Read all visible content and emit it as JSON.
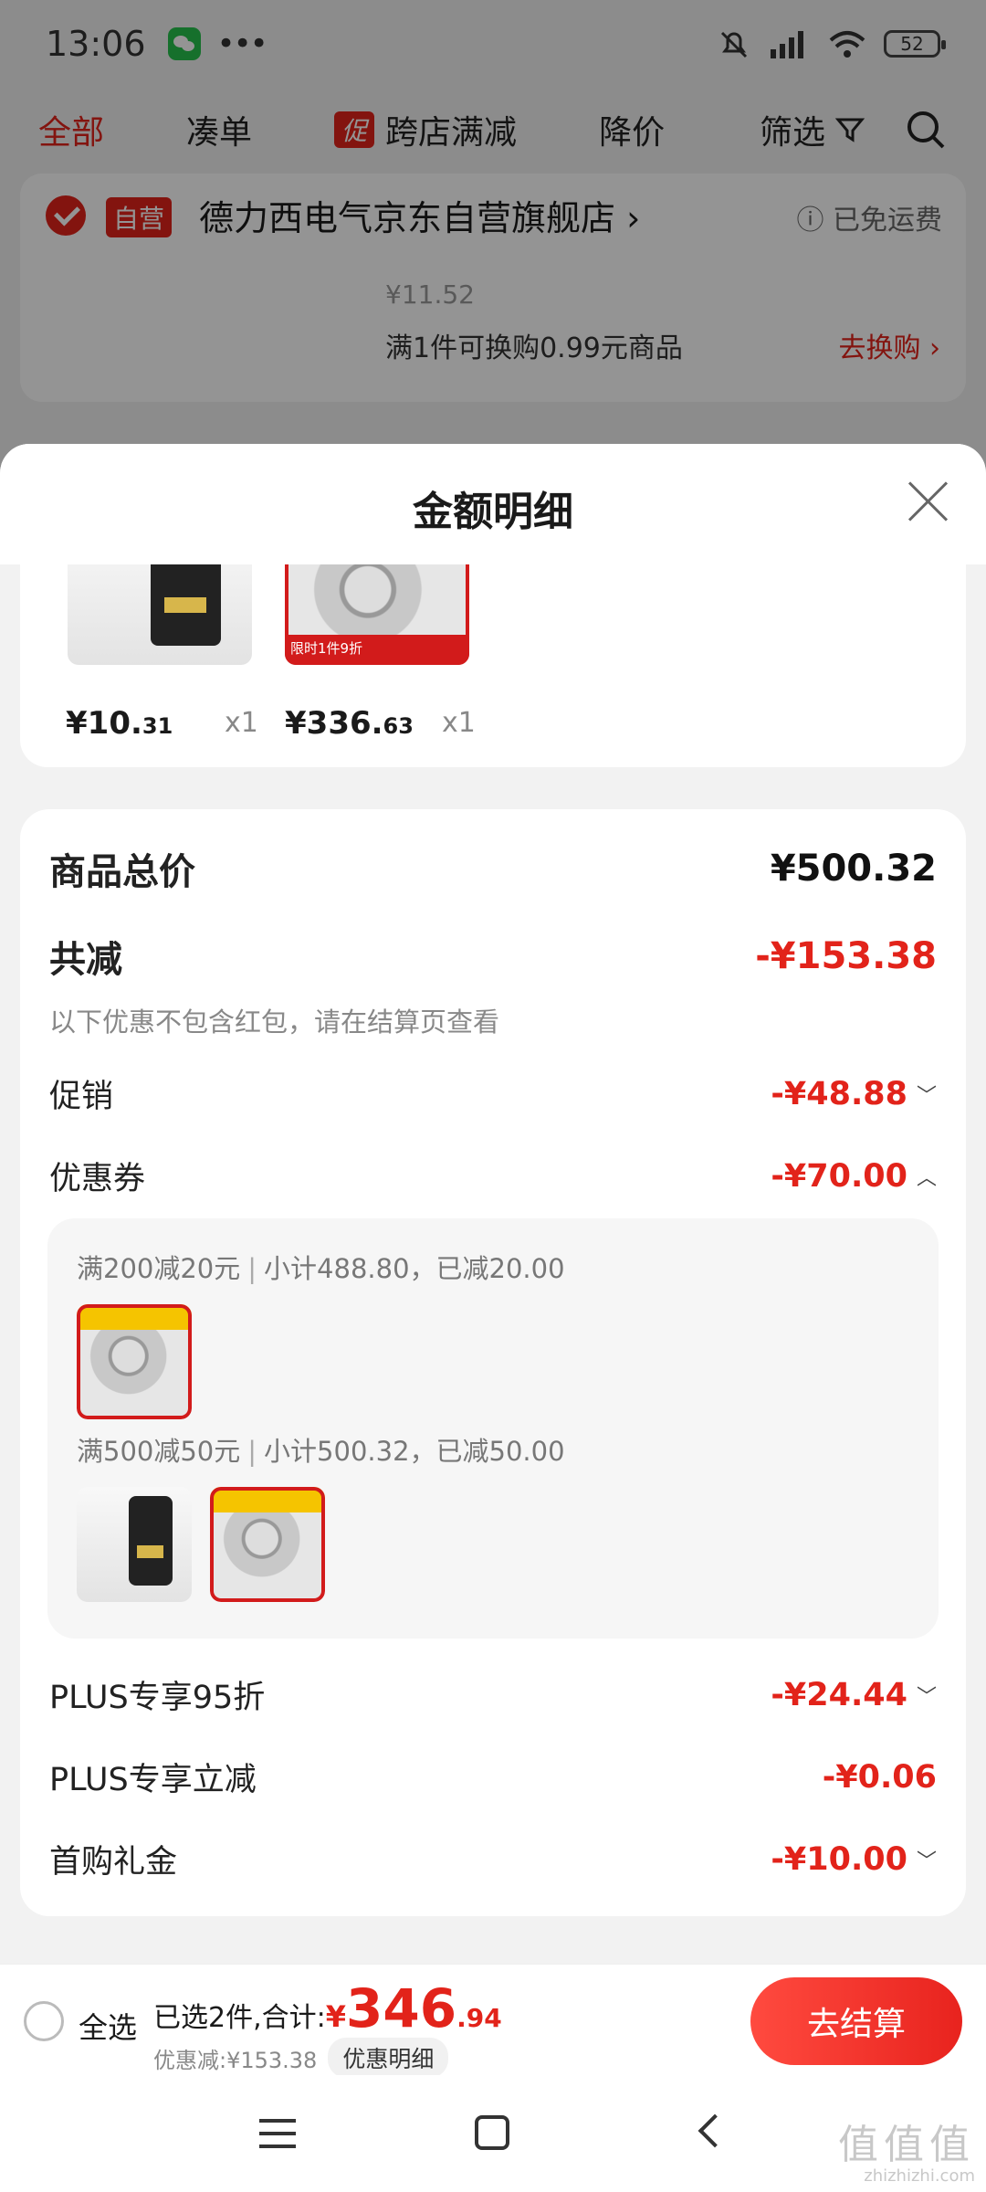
{
  "status_bar": {
    "time": "13:06",
    "battery": "52"
  },
  "tabs": {
    "all": "全部",
    "bundle": "凑单",
    "promo_badge": "促",
    "cross_store": "跨店满减",
    "price_drop": "降价",
    "filter": "筛选"
  },
  "store": {
    "badge": "自营",
    "name": "德力西电气京东自营旗舰店 ›",
    "shipping": "ⓘ 已免运费",
    "price": "¥11.52",
    "promo": "满1件可换购0.99元商品",
    "swap": "去换购 ›"
  },
  "sheet": {
    "title": "金额明细"
  },
  "products": [
    {
      "price_int": "¥10.",
      "price_dec": "31",
      "qty": "x1"
    },
    {
      "price_int": "¥336.",
      "price_dec": "63",
      "qty": "x1",
      "tag": "限时1件9折"
    }
  ],
  "summary": {
    "goods_total_label": "商品总价",
    "goods_total_value": "¥500.32",
    "total_discount_label": "共减",
    "total_discount_value": "-¥153.38",
    "hint": "以下优惠不包含红包，请在结算页查看",
    "promotion_label": "促销",
    "promotion_value": "-¥48.88",
    "coupon_label": "优惠券",
    "coupon_value": "-¥70.00",
    "coupon1_rule": "满200减20元",
    "coupon1_detail": "小计488.80，已减20.00",
    "coupon2_rule": "满500减50元",
    "coupon2_detail": "小计500.32，已减50.00",
    "plus95_label": "PLUS专享95折",
    "plus95_value": "-¥24.44",
    "plus_cut_label": "PLUS专享立减",
    "plus_cut_value": "-¥0.06",
    "first_gift_label": "首购礼金",
    "first_gift_value": "-¥10.00"
  },
  "bottom_bar": {
    "select_all": "全选",
    "selected_text": "已选2件,合计:",
    "currency": "¥",
    "total_int": "346",
    "total_dec": ".94",
    "discount": "优惠减:¥153.38",
    "detail_button": "优惠明细",
    "checkout": "去结算"
  },
  "watermark": {
    "text": "值值值",
    "url": "zhizhizhi.com"
  },
  "colors": {
    "accent": "#e2231a"
  }
}
